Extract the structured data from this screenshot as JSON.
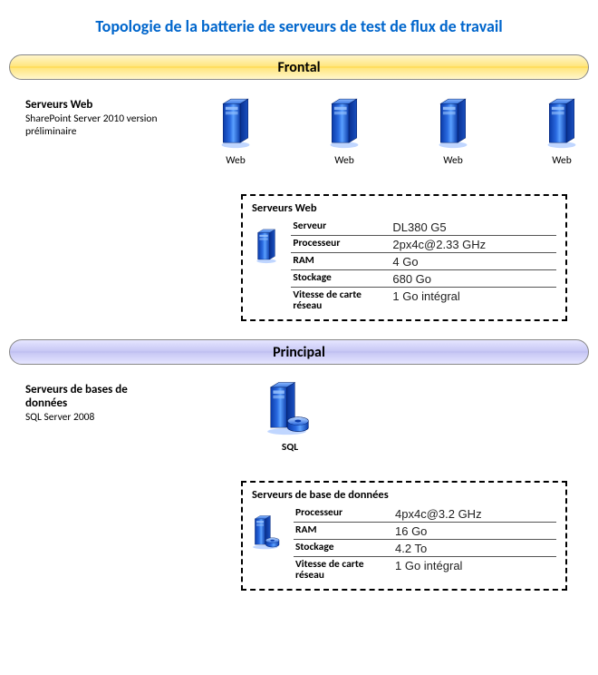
{
  "title": "Topologie de la batterie de serveurs de test de flux de travail",
  "tiers": {
    "frontal": {
      "bar": "Frontal",
      "side_header": "Serveurs Web",
      "side_sub": "SharePoint Server 2010 version préliminaire",
      "servers": [
        "Web",
        "Web",
        "Web",
        "Web"
      ],
      "spec_title": "Serveurs Web",
      "specs": [
        {
          "k": "Serveur",
          "v": "DL380 G5"
        },
        {
          "k": "Processeur",
          "v": "2px4c@2.33 GHz"
        },
        {
          "k": "RAM",
          "v": "4 Go"
        },
        {
          "k": "Stockage",
          "v": "680 Go"
        },
        {
          "k": "Vitesse de carte réseau",
          "v": "1 Go intégral"
        }
      ]
    },
    "principal": {
      "bar": "Principal",
      "side_header": "Serveurs de bases de données",
      "side_sub": "SQL Server 2008",
      "servers": [
        "SQL"
      ],
      "spec_title": "Serveurs de base de données",
      "specs": [
        {
          "k": "Processeur",
          "v": "4px4c@3.2 GHz"
        },
        {
          "k": "RAM",
          "v": "16 Go"
        },
        {
          "k": "Stockage",
          "v": "4.2 To"
        },
        {
          "k": "Vitesse de carte réseau",
          "v": "1 Go intégral"
        }
      ]
    }
  }
}
